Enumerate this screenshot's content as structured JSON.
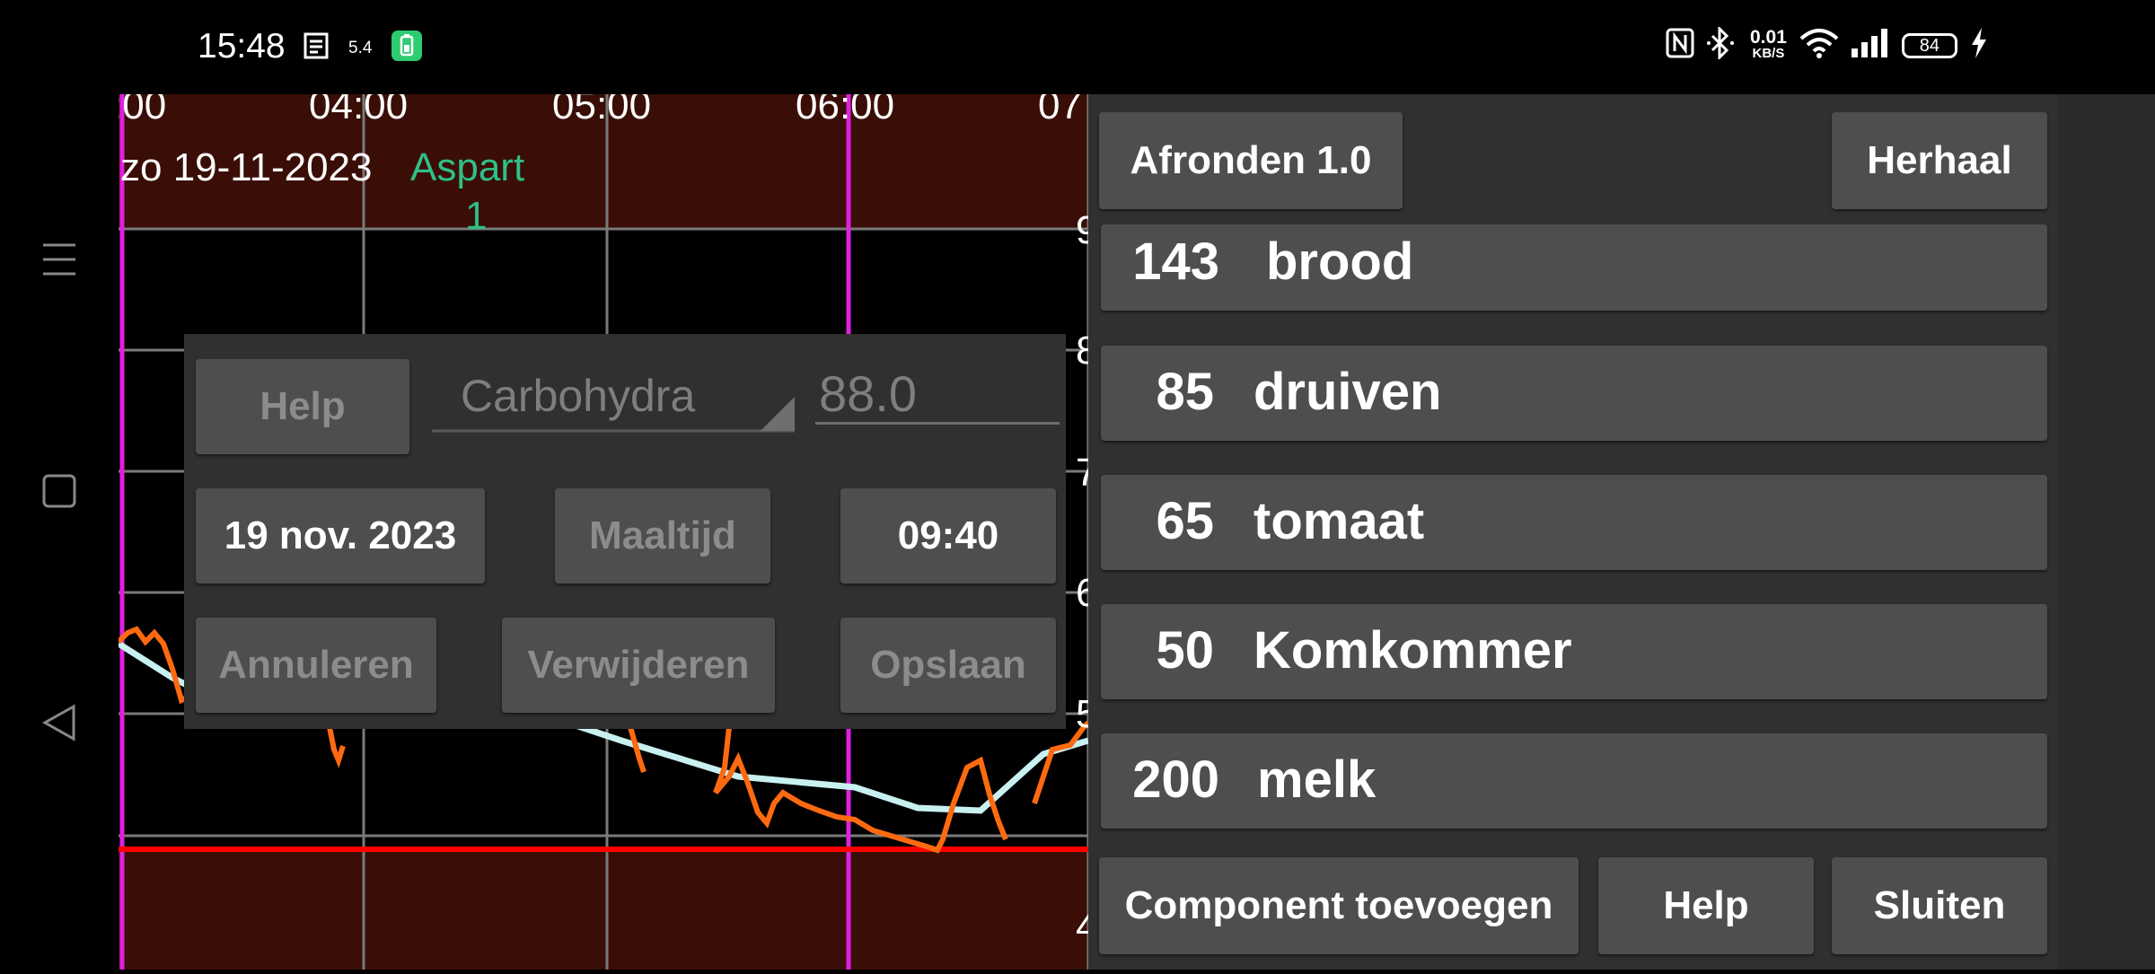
{
  "status_bar": {
    "time": "15:48",
    "network_small": "5.4",
    "speed_value": "0.01",
    "speed_unit": "KB/S",
    "battery": "84",
    "icons": [
      "notes-icon",
      "battery-saver-icon",
      "nfc-icon",
      "bluetooth-icon",
      "wifi-icon",
      "signal-icon",
      "charging-icon"
    ]
  },
  "nav": {
    "icons": [
      "menu-icon",
      "home-square-icon",
      "back-triangle-icon"
    ]
  },
  "chart": {
    "time_labels": [
      ":00",
      "04:00",
      "05:00",
      "06:00",
      "07"
    ],
    "date_label": "zo 19-11-2023",
    "event_name": "Aspart",
    "event_value": "1",
    "y_edge_labels": [
      "9",
      "8",
      "7",
      "6",
      "5",
      "4"
    ],
    "colors": {
      "bg_band": "#3a0e06",
      "grid": "#7a7a7a",
      "marker": "#e020e0",
      "low_line": "#ff0000",
      "glucose": "#ff6a10",
      "trend": "#c8f0f0",
      "event": "#2fbf88"
    }
  },
  "dialog": {
    "help": "Help",
    "type": "Carbohydra",
    "value": "88.0",
    "date": "19 nov. 2023",
    "meal": "Maaltijd",
    "time": "09:40",
    "cancel": "Annuleren",
    "delete": "Verwijderen",
    "save": "Opslaan"
  },
  "panel": {
    "round": "Afronden 1.0",
    "repeat": "Herhaal",
    "items": [
      {
        "amount": "143",
        "name": "brood"
      },
      {
        "amount": "85",
        "name": "druiven"
      },
      {
        "amount": "65",
        "name": "tomaat"
      },
      {
        "amount": "50",
        "name": "Komkommer"
      },
      {
        "amount": "200",
        "name": "melk"
      }
    ],
    "add_component": "Component toevoegen",
    "help": "Help",
    "close": "Sluiten"
  }
}
